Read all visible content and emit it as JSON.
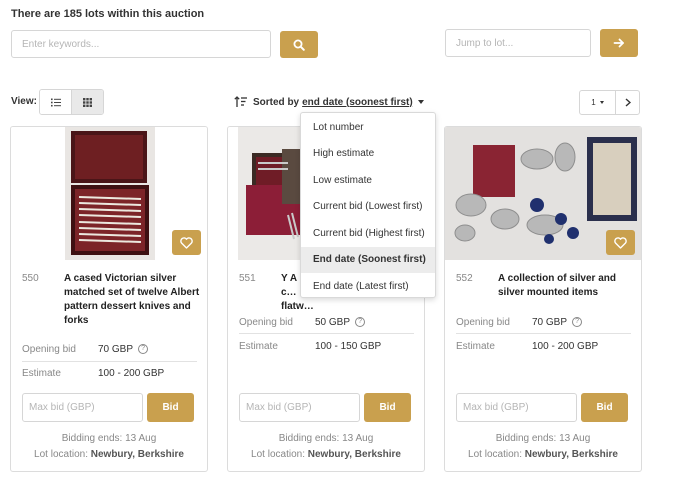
{
  "header": {
    "lots_count": "There are 185 lots within this auction"
  },
  "search": {
    "placeholder": "Enter keywords...",
    "jump_placeholder": "Jump to lot..."
  },
  "view": {
    "label": "View:"
  },
  "sort": {
    "label": "Sorted by",
    "value": "end date (soonest first)",
    "options": [
      {
        "label": "Lot number",
        "active": false
      },
      {
        "label": "High estimate",
        "active": false
      },
      {
        "label": "Low estimate",
        "active": false
      },
      {
        "label": "Current bid (Lowest first)",
        "active": false
      },
      {
        "label": "Current bid (Highest first)",
        "active": false
      },
      {
        "label": "End date (Soonest first)",
        "active": true
      },
      {
        "label": "End date (Latest first)",
        "active": false
      }
    ]
  },
  "pager": {
    "page": "1"
  },
  "colors": {
    "accent": "#c9a04e"
  },
  "lots": [
    {
      "number": "550",
      "title": "A cased Victorian silver matched set of twelve Albert pattern dessert knives and forks",
      "opening_bid_label": "Opening bid",
      "opening_bid": "70 GBP",
      "estimate_label": "Estimate",
      "estimate": "100 - 200 GBP",
      "maxbid_placeholder": "Max bid (GBP)",
      "bid_label": "Bid",
      "ends": "Bidding ends: 13 Aug",
      "location_label": "Lot location:",
      "location": "Newbury, Berkshire"
    },
    {
      "number": "551",
      "title": "Y A c… flatw…",
      "opening_bid_label": "Opening bid",
      "opening_bid": "50 GBP",
      "estimate_label": "Estimate",
      "estimate": "100 - 150 GBP",
      "maxbid_placeholder": "Max bid (GBP)",
      "bid_label": "Bid",
      "ends": "Bidding ends: 13 Aug",
      "location_label": "Lot location:",
      "location": "Newbury, Berkshire"
    },
    {
      "number": "552",
      "title": "A collection of silver and silver mounted items",
      "opening_bid_label": "Opening bid",
      "opening_bid": "70 GBP",
      "estimate_label": "Estimate",
      "estimate": "100 - 200 GBP",
      "maxbid_placeholder": "Max bid (GBP)",
      "bid_label": "Bid",
      "ends": "Bidding ends: 13 Aug",
      "location_label": "Lot location:",
      "location": "Newbury, Berkshire"
    }
  ]
}
